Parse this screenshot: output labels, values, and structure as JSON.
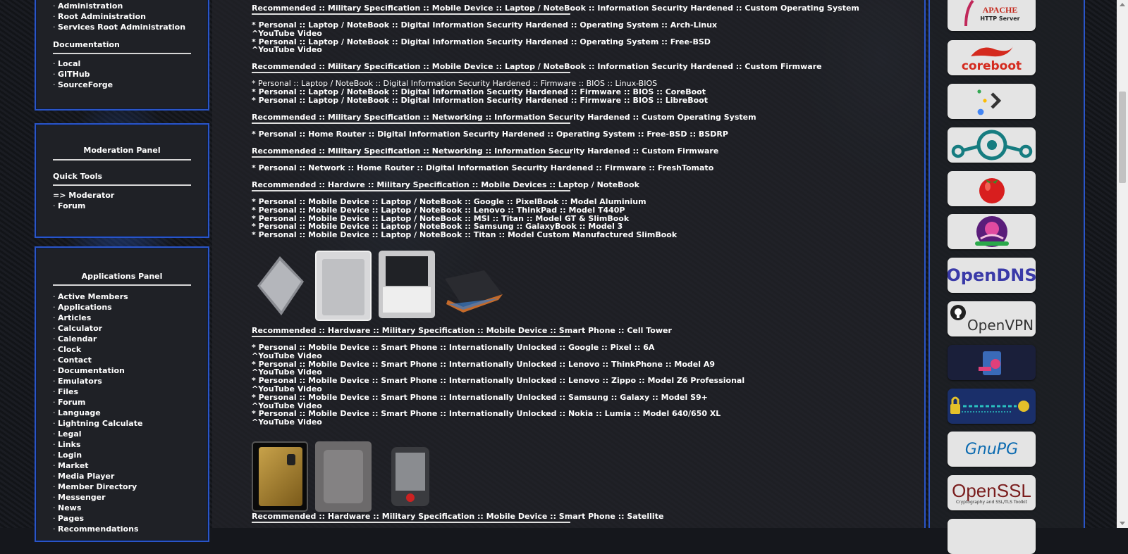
{
  "sidebar": {
    "admin_items": [
      "Administration",
      "Root Administration",
      "Services Root Administration"
    ],
    "documentation": {
      "heading": "Documentation",
      "items": [
        "Local",
        "GITHub",
        "SourceForge"
      ]
    },
    "moderation": {
      "title": "Moderation Panel",
      "quick_tools": "Quick Tools",
      "moderator": "=> Moderator",
      "forum": "Forum"
    },
    "applications": {
      "title": "Applications Panel",
      "items": [
        "Active Members",
        "Applications",
        "Articles",
        "Calculator",
        "Calendar",
        "Clock",
        "Contact",
        "Documentation",
        "Emulators",
        "Files",
        "Forum",
        "Language",
        "Lightning Calculate",
        "Legal",
        "Links",
        "Login",
        "Market",
        "Media Player",
        "Member Directory",
        "Messenger",
        "News",
        "Pages",
        "Recommendations"
      ]
    }
  },
  "content": {
    "sections": [
      {
        "heading": "Recommended :: Military Specification :: Mobile Device :: Laptop / NoteBook :: Information Security Hardened :: Custom Operating System",
        "lines": [
          "* Personal :: Laptop / NoteBook :: Digital Information Security Hardened :: Operating System :: Arch-Linux",
          "^YouTube Video",
          "* Personal :: Laptop / NoteBook :: Digital Information Security Hardened :: Operating System :: Free-BSD",
          "^YouTube Video"
        ]
      },
      {
        "heading": "Recommended :: Military Specification :: Mobile Device :: Laptop / NoteBook :: Information Security Hardened :: Custom Firmware",
        "lines": [
          "* Personal :: Laptop / NoteBook :: Digital Information Security Hardened :: Firmware :: BIOS :: Linux-BIOS",
          "* Personal :: Laptop / NoteBook :: Digital Information Security Hardened :: Firmware :: BIOS :: CoreBoot",
          "* Personal :: Laptop / NoteBook :: Digital Information Security Hardened :: Firmware :: BIOS :: LibreBoot"
        ]
      },
      {
        "heading": "Recommended :: Military Specification :: Networking :: Information Security Hardened :: Custom Operating System",
        "lines": [
          "* Personal :: Home Router :: Digital Information Security Hardened :: Operating System :: Free-BSD :: BSDRP"
        ]
      },
      {
        "heading": "Recommended :: Military Specification :: Networking :: Information Security Hardened :: Custom Firmware",
        "lines": [
          "* Personal :: Network :: Home Router :: Digital Information Security Hardened :: Firmware :: FreshTomato"
        ]
      },
      {
        "heading": "Recommended :: Hardwre :: Military Specification :: Mobile Devices :: Laptop / NoteBook",
        "lines": [
          "* Personal :: Mobile Device :: Laptop / NoteBook :: Google :: PixelBook :: Model Aluminium",
          "* Personal :: Mobile Device :: Laptop / NoteBook :: Lenovo :: ThinkPad :: Model T440P",
          "* Personal :: Mobile Device :: Laptop / NoteBook :: MSI :: Titan :: Model GT & SlimBook",
          "* Personal :: Mobile Device :: Laptop / NoteBook :: Samsung :: GalaxyBook :: Model 3",
          "* Personal :: Mobile Device :: Laptop / NoteBook :: Titan :: Model Custom Manufactured SlimBook"
        ]
      },
      {
        "heading": "Recommended :: Hardware :: Military Specification :: Mobile Device :: Smart Phone :: Cell Tower",
        "lines": [
          "* Personal :: Mobile Device :: Smart Phone :: Internationally Unlocked :: Google :: Pixel :: 6A",
          "^YouTube Video",
          "* Personal :: Mobile Device :: Smart Phone :: Internationally Unlocked :: Lenovo :: ThinkPhone :: Model A9",
          "^YouTube Video",
          "* Personal :: Mobile Device :: Smart Phone :: Internationally Unlocked :: Lenovo :: Zippo :: Model Z6 Professional",
          "^YouTube Video",
          "* Personal :: Mobile Device :: Smart Phone :: Internationally Unlocked :: Samsung :: Galaxy :: Model S9+",
          "^YouTube Video",
          "* Personal :: Mobile Device :: Smart Phone :: Internationally Unlocked :: Nokia :: Lumia :: Model 640/650 XL",
          "^YouTube Video"
        ]
      },
      {
        "heading": "Recommended :: Hardware :: Military Specification :: Mobile Device :: Smart Phone :: Satellite",
        "lines": []
      }
    ]
  },
  "logos": {
    "apache": {
      "name": "APACHE",
      "sub": "HTTP Server"
    },
    "coreboot": "coreboot",
    "opendns": "OpenDNS",
    "openvpn": "OpenVPN",
    "gnupg": "GnuPG",
    "openssl": {
      "name": "OpenSSL",
      "sub": "Cryptography and SSL/TLS Toolkit"
    }
  },
  "colors": {
    "accent_border": "#2a55c8",
    "panel_bg": "#1f2126",
    "coreboot_red": "#d42a1e",
    "opendns_blue": "#3a3aa8",
    "openssl_maroon": "#7a1d1d"
  }
}
